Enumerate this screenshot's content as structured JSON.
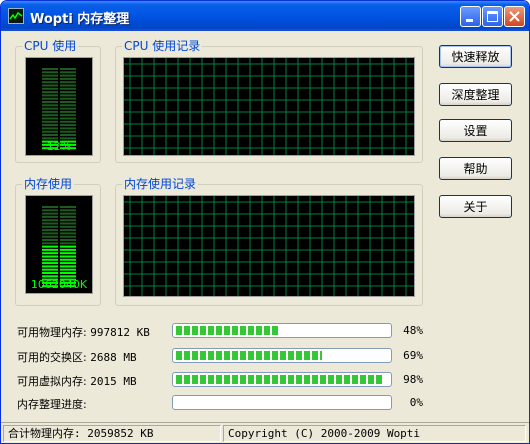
{
  "window": {
    "title": "Wopti 内存整理"
  },
  "cpu": {
    "group_label": "CPU 使用",
    "history_label": "CPU 使用记录",
    "meter_text": "12%",
    "usage_fraction": 0.12
  },
  "memory": {
    "group_label": "内存使用",
    "history_label": "内存使用记录",
    "meter_text": "1062040K",
    "usage_fraction": 0.52
  },
  "buttons": {
    "quick_release": "快速释放",
    "deep_clean": "深度整理",
    "settings": "设置",
    "help": "帮助",
    "close": "关于"
  },
  "stats": [
    {
      "label": "可用物理内存:",
      "value": "997812 KB",
      "percent_text": "48%",
      "fraction": 0.48
    },
    {
      "label": "可用的交换区:",
      "value": "2688 MB",
      "percent_text": "69%",
      "fraction": 0.69
    },
    {
      "label": "可用虚拟内存:",
      "value": "2015 MB",
      "percent_text": "98%",
      "fraction": 0.98
    },
    {
      "label": "内存整理进度:",
      "value": "",
      "percent_text": "0%",
      "fraction": 0.0
    }
  ],
  "statusbar": {
    "total": "合计物理内存: 2059852 KB",
    "copyright": "Copyright (C) 2000-2009 Wopti"
  },
  "colors": {
    "graph_bg": "#000000",
    "grid": "#008040",
    "meter_on": "#00ff00",
    "meter_off": "#1f5a1f",
    "progress": "#34c834",
    "title_bar": "#0054e3"
  },
  "icons": {
    "app": "app-graph-icon",
    "minimize": "minimize-icon",
    "maximize": "maximize-icon",
    "close": "close-icon"
  }
}
